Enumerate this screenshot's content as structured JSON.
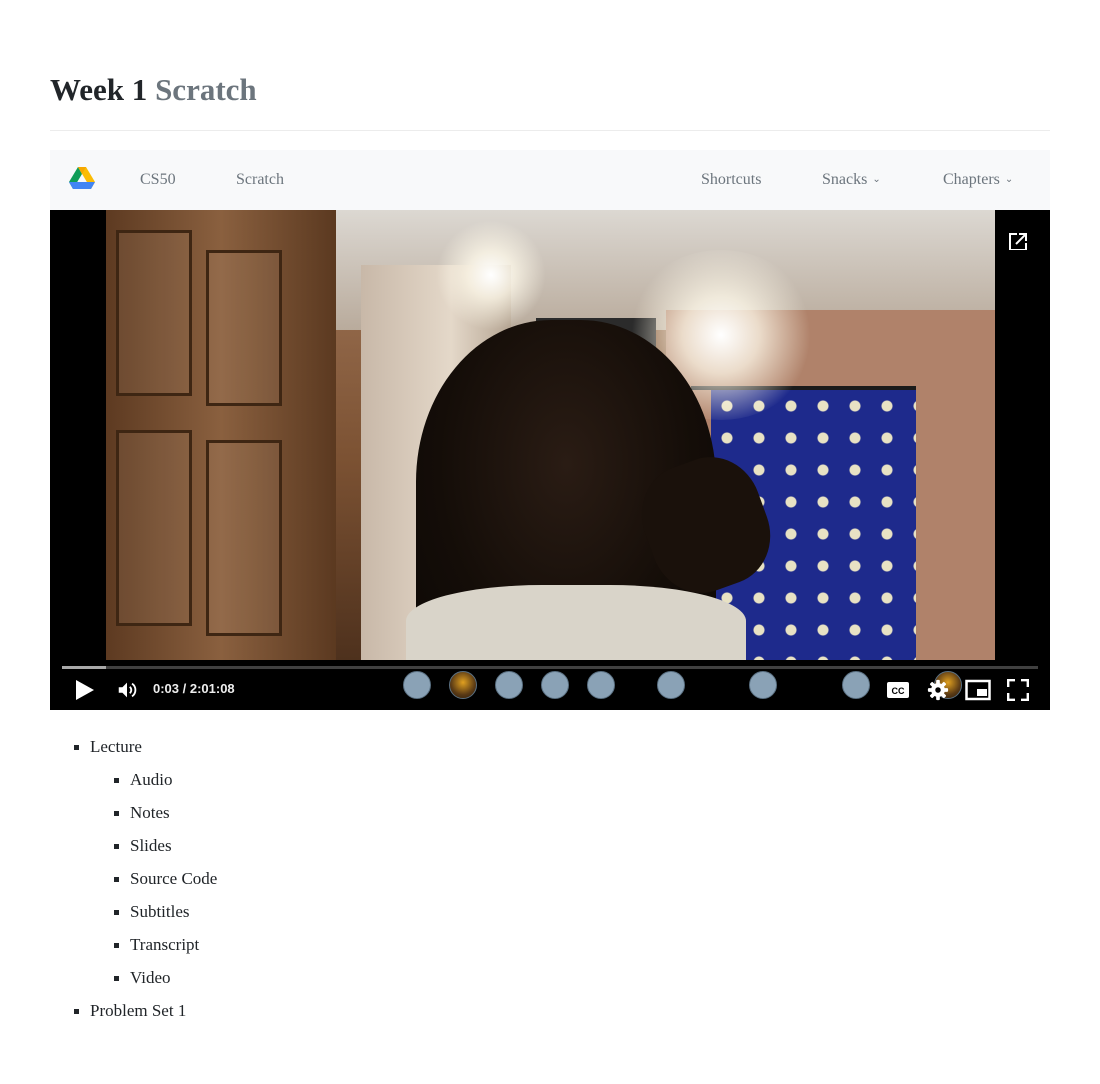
{
  "page": {
    "title_week": "Week 1",
    "title_topic": "Scratch"
  },
  "navbar": {
    "links": {
      "cs50": "CS50",
      "scratch": "Scratch",
      "shortcuts": "Shortcuts",
      "snacks": "Snacks",
      "chapters": "Chapters"
    },
    "caret_icon": "chevron-down-icon"
  },
  "video": {
    "time_display": "0:03 / 2:01:08",
    "progress_fraction": 0.045,
    "controls": [
      "play-icon",
      "volume-icon",
      "captions-icon",
      "settings-icon",
      "miniplayer-icon",
      "fullscreen-icon",
      "open-in-new-icon"
    ]
  },
  "menu": {
    "lecture": "Lecture",
    "lecture_items": [
      "Audio",
      "Notes",
      "Slides",
      "Source Code",
      "Subtitles",
      "Transcript",
      "Video"
    ],
    "problem_set": "Problem Set 1"
  },
  "colors": {
    "title_muted": "#6c757d",
    "navbar_bg": "#f8f9fa",
    "video_bg": "#000000"
  }
}
